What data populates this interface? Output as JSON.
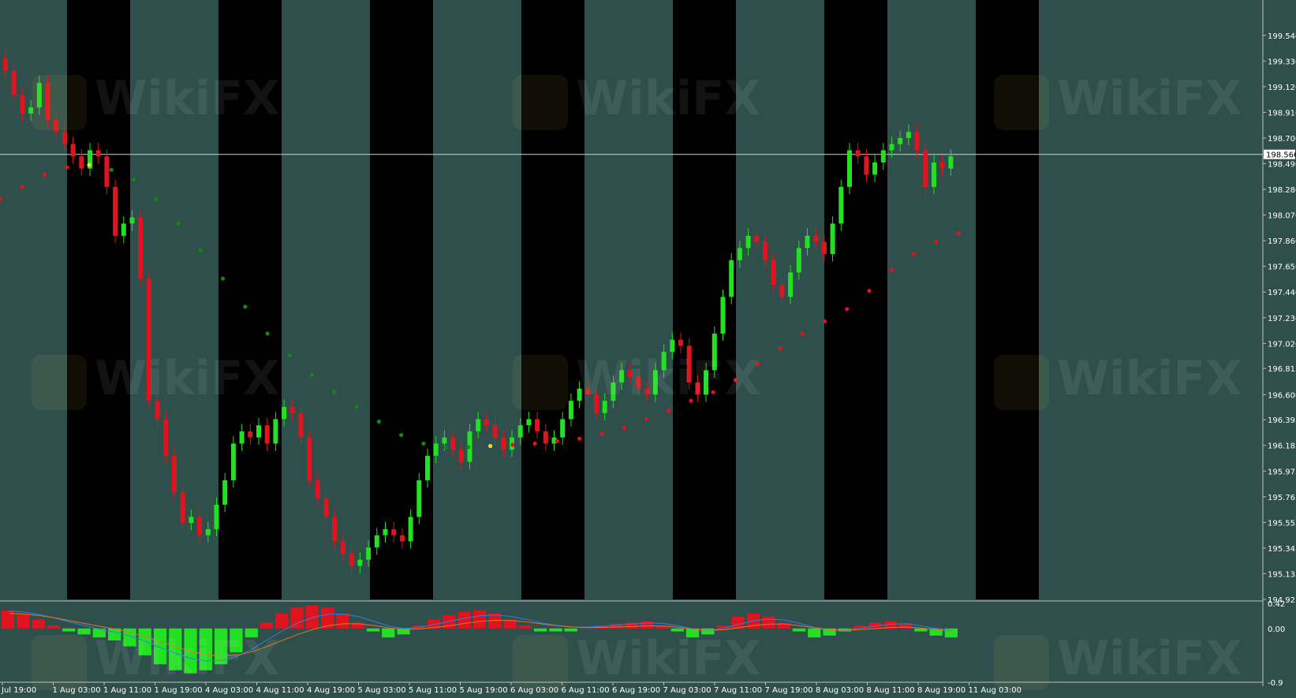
{
  "chart_data": [
    {
      "type": "candlestick",
      "panel": "price",
      "ylim": [
        194.925,
        199.7
      ],
      "y_ticks": [
        "199.540",
        "199.330",
        "199.120",
        "198.910",
        "198.700",
        "198.490",
        "198.280",
        "198.070",
        "197.860",
        "197.650",
        "197.440",
        "197.230",
        "197.020",
        "196.815",
        "196.600",
        "196.395",
        "196.185",
        "195.975",
        "195.765",
        "195.555",
        "195.345",
        "195.135",
        "194.925"
      ],
      "current_price": "198.566",
      "x_labels": [
        "Jul 19:00",
        "1 Aug 03:00",
        "1 Aug 11:00",
        "1 Aug 19:00",
        "4 Aug 03:00",
        "4 Aug 11:00",
        "4 Aug 19:00",
        "5 Aug 03:00",
        "5 Aug 11:00",
        "5 Aug 19:00",
        "6 Aug 03:00",
        "6 Aug 11:00",
        "6 Aug 19:00",
        "7 Aug 03:00",
        "7 Aug 11:00",
        "7 Aug 19:00",
        "8 Aug 03:00",
        "8 Aug 11:00",
        "8 Aug 19:00",
        "11 Aug 03:00"
      ],
      "close": [
        199.25,
        199.05,
        198.9,
        198.95,
        199.15,
        198.85,
        198.75,
        198.65,
        198.55,
        198.45,
        198.6,
        198.55,
        198.3,
        197.9,
        198.0,
        198.05,
        197.55,
        196.55,
        196.4,
        196.1,
        195.8,
        195.55,
        195.6,
        195.45,
        195.5,
        195.7,
        195.9,
        196.2,
        196.3,
        196.25,
        196.35,
        196.2,
        196.4,
        196.5,
        196.45,
        196.25,
        195.9,
        195.75,
        195.6,
        195.4,
        195.3,
        195.2,
        195.25,
        195.35,
        195.45,
        195.5,
        195.45,
        195.4,
        195.6,
        195.9,
        196.1,
        196.2,
        196.25,
        196.15,
        196.05,
        196.3,
        196.4,
        196.35,
        196.25,
        196.15,
        196.25,
        196.35,
        196.4,
        196.3,
        196.2,
        196.25,
        196.4,
        196.55,
        196.65,
        196.6,
        196.45,
        196.55,
        196.7,
        196.8,
        196.75,
        196.65,
        196.6,
        196.8,
        196.95,
        197.05,
        197.0,
        196.7,
        196.6,
        196.8,
        197.1,
        197.4,
        197.7,
        197.8,
        197.9,
        197.85,
        197.7,
        197.5,
        197.4,
        197.6,
        197.8,
        197.9,
        197.85,
        197.75,
        198.0,
        198.3,
        198.6,
        198.55,
        198.4,
        198.5,
        198.6,
        198.65,
        198.7,
        198.75,
        198.6,
        198.3,
        198.5,
        198.45,
        198.55
      ],
      "series": [
        {
          "name": "",
          "color": "#e0141e",
          "values": [
            198.2,
            198.3,
            198.4,
            198.46,
            198.48,
            198.44,
            198.36,
            198.2,
            198.0,
            197.78,
            197.55,
            197.32,
            197.1,
            196.92,
            196.76,
            196.62,
            196.5,
            196.38,
            196.27,
            196.2,
            196.17,
            196.17,
            196.18,
            196.19,
            196.2,
            196.22,
            196.24,
            196.28,
            196.33,
            196.4,
            196.47,
            196.55,
            196.62,
            196.72,
            196.85,
            196.98,
            197.1,
            197.2,
            197.3,
            197.45,
            197.62,
            197.75,
            197.85,
            197.92
          ]
        }
      ]
    },
    {
      "type": "bar",
      "panel": "oscillator",
      "ylim": [
        -0.9,
        0.42
      ],
      "y_ticks": [
        "0.42",
        "0.00",
        "-0.9"
      ],
      "values": [
        0.3,
        0.25,
        0.15,
        0.05,
        -0.05,
        -0.1,
        -0.15,
        -0.2,
        -0.3,
        -0.45,
        -0.6,
        -0.7,
        -0.75,
        -0.7,
        -0.6,
        -0.4,
        -0.15,
        0.1,
        0.25,
        0.35,
        0.38,
        0.35,
        0.25,
        0.1,
        -0.05,
        -0.15,
        -0.1,
        0.05,
        0.15,
        0.22,
        0.28,
        0.3,
        0.25,
        0.15,
        0.05,
        -0.05,
        -0.05,
        -0.05,
        0.0,
        0.05,
        0.08,
        0.1,
        0.12,
        0.05,
        -0.05,
        -0.15,
        -0.1,
        0.05,
        0.2,
        0.25,
        0.2,
        0.1,
        -0.05,
        -0.15,
        -0.12,
        -0.05,
        0.05,
        0.1,
        0.12,
        0.08,
        -0.05,
        -0.12,
        -0.15
      ],
      "series": [
        {
          "name": "",
          "color": "#2f7fe6"
        },
        {
          "name": "",
          "color": "#e0781e"
        }
      ]
    }
  ],
  "colors": {
    "up": "#22e022",
    "down": "#e0141e",
    "signal_up": "#118811",
    "signal_neutral": "#f2e11a",
    "bg_light": "#2f4f4c",
    "bg_dark": "#000000"
  },
  "watermark": "WikiFX"
}
